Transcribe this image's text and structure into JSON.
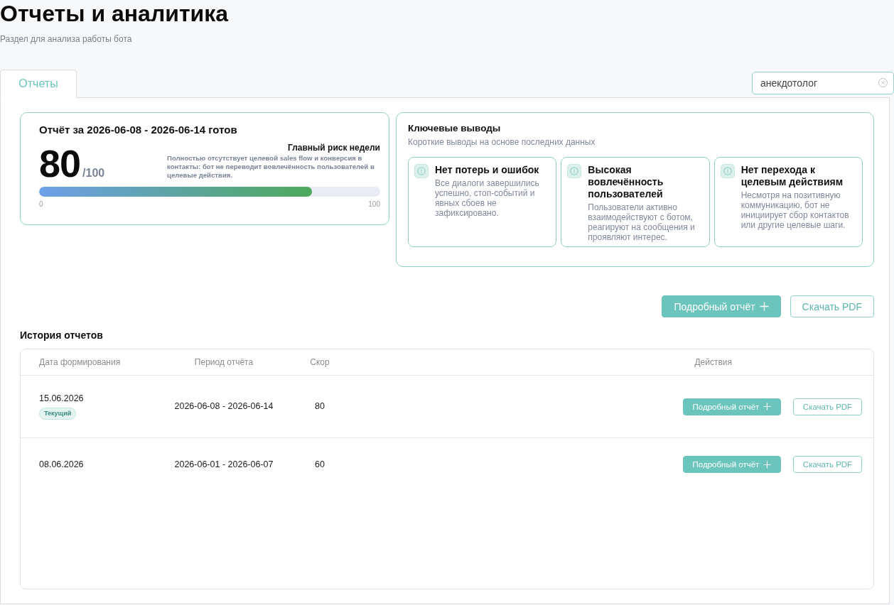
{
  "page": {
    "title": "Отчеты и аналитика",
    "subtitle": "Раздел для анализа работы бота"
  },
  "tabs": [
    {
      "label": "Отчеты",
      "selected": true
    }
  ],
  "search": {
    "value": "анекдотолог"
  },
  "report_card": {
    "title": "Отчёт за 2026-06-08 - 2026-06-14 готов",
    "score": "80",
    "score_max": "/100",
    "level": 0.8,
    "scale_min": "0",
    "scale_max": "100",
    "risk_title": "Главный риск недели",
    "risk_text": "Полностью отсутствует целевой sales flow и конверсия в контакты: бот не переводит вовлечённость пользователей в целевые действия."
  },
  "key_findings": {
    "title": "Ключевые выводы",
    "subtitle": "Короткие выводы на основе последних данных",
    "items": [
      {
        "title": "Нет потерь и ошибок",
        "text": "Все диалоги завершились успешно, стоп-событий и явных сбоев не зафиксировано."
      },
      {
        "title": "Высокая вовлечённость пользователей",
        "text": "Пользователи активно взаимодействуют с ботом, реагируют на сообщения и проявляют интерес."
      },
      {
        "title": "Нет перехода к целевым действиям",
        "text": "Несмотря на позитивную коммуникацию, бот не инициирует сбор контактов или другие целевые шаги."
      }
    ]
  },
  "actions": [
    {
      "kind": "primary",
      "label": "Подробный отчёт"
    },
    {
      "kind": "outline",
      "label": "Скачать PDF"
    }
  ],
  "history": {
    "title": "История отчетов",
    "columns": [
      "Дата формирования",
      "Период отчёта",
      "Скор",
      "Действия"
    ],
    "rows": [
      {
        "date": "15.06.2026",
        "badge": "Текущий",
        "period": "2026-06-08 - 2026-06-14",
        "score": "80",
        "actions": [
          {
            "kind": "primary",
            "label": "Подробный отчёт"
          },
          {
            "kind": "outline",
            "label": "Скачать PDF"
          }
        ]
      },
      {
        "date": "08.06.2026",
        "period": "2026-06-01 - 2026-06-07",
        "score": "60",
        "actions": [
          {
            "kind": "primary",
            "label": "Подробный отчёт"
          },
          {
            "kind": "outline",
            "label": "Скачать PDF"
          }
        ]
      }
    ]
  }
}
